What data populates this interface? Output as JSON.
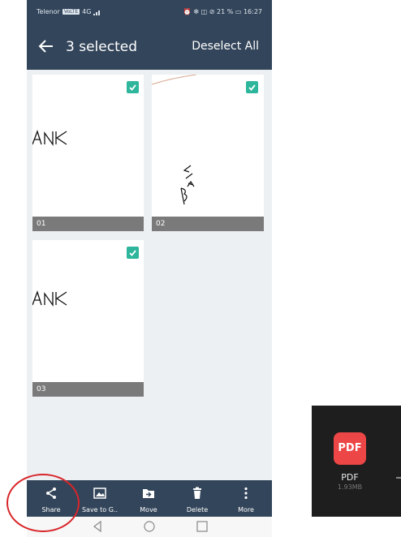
{
  "status_bar": {
    "carrier": "Telenor",
    "network_badge": "VoLTE",
    "network_type": "4G",
    "right": "⏰ ✻ ◫ ⊘ 21 % ▭ 16:27"
  },
  "header": {
    "title": "3 selected",
    "deselect_all": "Deselect All"
  },
  "pages": [
    {
      "label": "01",
      "selected": true
    },
    {
      "label": "02",
      "selected": true
    },
    {
      "label": "03",
      "selected": true
    }
  ],
  "actions": [
    {
      "label": "Share",
      "icon": "share-icon"
    },
    {
      "label": "Save to G..",
      "icon": "image-icon"
    },
    {
      "label": "Move",
      "icon": "move-folder-icon"
    },
    {
      "label": "Delete",
      "icon": "trash-icon"
    },
    {
      "label": "More",
      "icon": "more-vertical-icon"
    }
  ],
  "share_popup": {
    "icon_text": "PDF",
    "name": "PDF",
    "size": "1.93MB"
  },
  "colors": {
    "header": "#33455a",
    "check": "#2db69c",
    "annotation": "#d8262a",
    "pdf": "#ec4646"
  }
}
